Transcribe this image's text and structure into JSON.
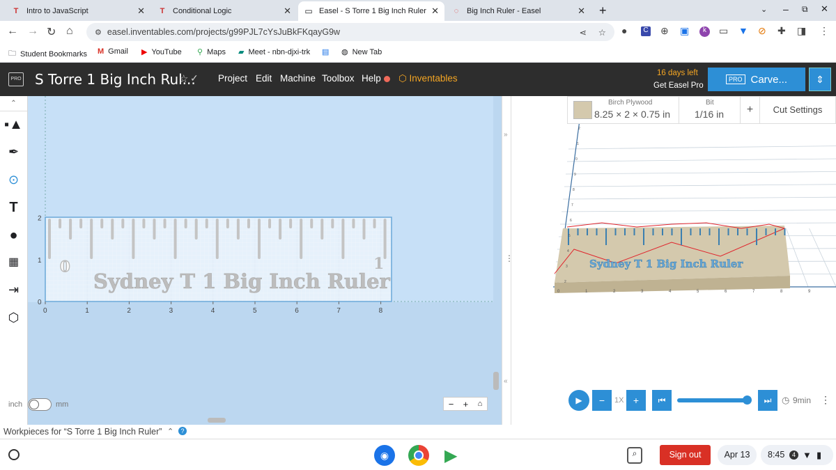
{
  "tabs": [
    {
      "title": "Intro to JavaScript",
      "active": false
    },
    {
      "title": "Conditional Logic",
      "active": false
    },
    {
      "title": "Easel - S Torre 1 Big Inch Ruler",
      "active": true
    },
    {
      "title": "Big Inch Ruler - Easel",
      "active": false
    }
  ],
  "address": {
    "url": "easel.inventables.com/projects/g99PJL7cYsJuBkFKqayG9w"
  },
  "bookmarks": [
    "Student Bookmarks",
    "Gmail",
    "YouTube",
    "Maps",
    "Meet - nbn-djxi-trk",
    "New Tab"
  ],
  "header": {
    "project_title": "S Torre 1 Big Inch Rul...",
    "menu": [
      "Project",
      "Edit",
      "Machine",
      "Toolbox",
      "Help"
    ],
    "inventables": "Inventables",
    "days_left": "16 days left",
    "get_pro": "Get Easel Pro",
    "pro_badge": "PRO",
    "carve": "Carve..."
  },
  "material": {
    "name": "Birch Plywood",
    "dims": "8.25 × 2 × 0.75 in"
  },
  "bit": {
    "label": "Bit",
    "value": "1/16 in"
  },
  "cut_settings": "Cut Settings",
  "design": {
    "ruler_text": "Sydney T 1 Big Inch Ruler",
    "zero_label": "0",
    "one_label": "1",
    "x_ticks": [
      "0",
      "1",
      "2",
      "3",
      "4",
      "5",
      "6",
      "7",
      "8"
    ],
    "y_ticks": [
      "0",
      "1",
      "2"
    ]
  },
  "preview": {
    "ruler_text": "Sydney T 1 Big Inch Ruler",
    "x_ticks": [
      "0",
      "1",
      "2",
      "3",
      "4",
      "5",
      "6",
      "7",
      "8",
      "9"
    ],
    "y_ticks": [
      "2",
      "1",
      "0",
      "9",
      "8",
      "7",
      "6",
      "5",
      "4",
      "3",
      "2"
    ],
    "speed": "1X",
    "time": "9min"
  },
  "units": {
    "left": "inch",
    "right": "mm"
  },
  "workpieces": "Workpieces for “S Torre 1 Big Inch Ruler”",
  "taskbar": {
    "signout": "Sign out",
    "date": "Apr 13",
    "time": "8:45",
    "badge": "4"
  },
  "colors": {
    "accent": "#2d8fd6",
    "header_bg": "#2d2d2d",
    "canvas_bg": "#bcd7f0",
    "inventables": "#f5a623",
    "signout": "#d93025"
  }
}
